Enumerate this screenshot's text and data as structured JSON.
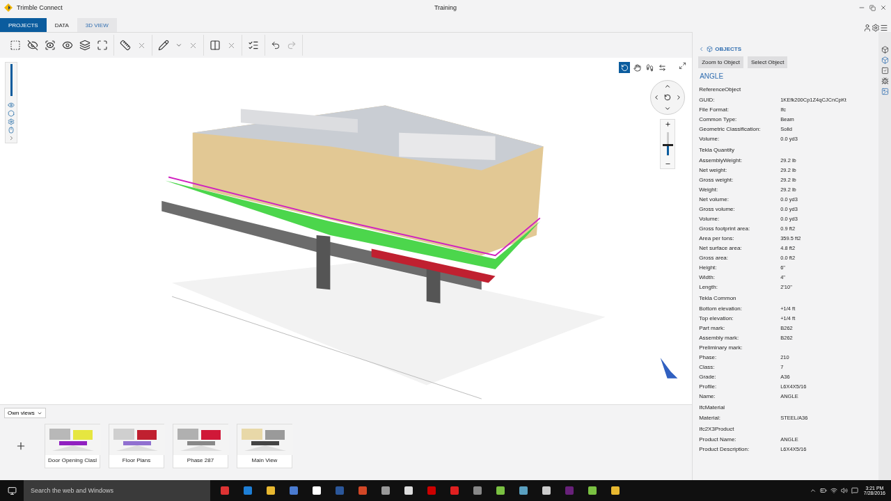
{
  "window": {
    "app_title": "Trimble Connect",
    "title": "Training"
  },
  "projects_button": "PROJECTS",
  "tabs": [
    {
      "label": "DATA",
      "selected": false
    },
    {
      "label": "3D VIEW",
      "selected": true
    }
  ],
  "toolbar": {
    "redo_disabled": true
  },
  "navigation_modes": [
    {
      "kind": "orbit",
      "selected": true
    },
    {
      "kind": "pan",
      "selected": false
    },
    {
      "kind": "walk",
      "selected": false
    },
    {
      "kind": "swap",
      "selected": false
    }
  ],
  "zoom": {
    "level": 0.45
  },
  "views": {
    "filter": "Own views",
    "items": [
      {
        "label": "Door Opening Clasl",
        "kind": "picture"
      },
      {
        "label": "Floor Plans",
        "kind": "picture"
      },
      {
        "label": "Phase 287",
        "kind": "picture"
      },
      {
        "label": "Main View",
        "kind": "picture"
      }
    ]
  },
  "panel": {
    "back_title": "OBJECTS",
    "buttons": [
      "Zoom to Object",
      "Select Object"
    ],
    "title": "ANGLE",
    "groups": [
      {
        "title": "ReferenceObject",
        "rows": [
          {
            "label": "GUID:",
            "value": "1KEfk200Cp1Z4qCJCnCpKt"
          },
          {
            "label": "File Format:",
            "value": "Ifc"
          },
          {
            "label": "Common Type:",
            "value": "Beam"
          },
          {
            "label": "Geometric Classification:",
            "value": "Solid"
          },
          {
            "label": "Volume:",
            "value": "0.0 yd3"
          }
        ]
      },
      {
        "title": "Tekla Quantity",
        "rows": [
          {
            "label": "AssemblyWeight:",
            "value": "29.2 lb"
          },
          {
            "label": "Net weight:",
            "value": "29.2 lb"
          },
          {
            "label": "Gross weight:",
            "value": "29.2 lb"
          },
          {
            "label": "Weight:",
            "value": "29.2 lb"
          },
          {
            "label": "Net volume:",
            "value": "0.0 yd3"
          },
          {
            "label": "Gross volume:",
            "value": "0.0 yd3"
          },
          {
            "label": "Volume:",
            "value": "0.0 yd3"
          },
          {
            "label": "Gross footprint area:",
            "value": "0.9 ft2"
          },
          {
            "label": "Area per tons:",
            "value": "359.5 ft2"
          },
          {
            "label": "Net surface area:",
            "value": "4.8 ft2"
          },
          {
            "label": "Gross area:",
            "value": "0.0 ft2"
          },
          {
            "label": "Height:",
            "value": "6\""
          },
          {
            "label": "Width:",
            "value": "4\""
          },
          {
            "label": "Length:",
            "value": "2'10\""
          }
        ]
      },
      {
        "title": "Tekla Common",
        "rows": [
          {
            "label": "Bottom elevation:",
            "value": "+1/4 ft"
          },
          {
            "label": "Top elevation:",
            "value": "+1/4 ft"
          },
          {
            "label": "Part mark:",
            "value": "B262"
          },
          {
            "label": "Assembly mark:",
            "value": "B262"
          },
          {
            "label": "Preliminary mark:"
          },
          {
            "label": "Phase:",
            "value": "210"
          },
          {
            "label": "Class:",
            "value": "7"
          },
          {
            "label": "Grade:",
            "value": "A36"
          },
          {
            "label": "Profile:",
            "value": "L6X4X5/16"
          },
          {
            "label": "Name:",
            "value": "ANGLE"
          }
        ]
      },
      {
        "title": "IfcMaterial",
        "rows": [
          {
            "label": "Material:",
            "value": "STEEL/A36"
          }
        ]
      },
      {
        "title": "Ifc2X3Product",
        "rows": [
          {
            "label": "Product Name:",
            "value": "ANGLE"
          },
          {
            "label": "Product Description:",
            "value": "L6X4X5/16"
          }
        ]
      }
    ]
  },
  "taskbar": {
    "search_placeholder": "Search the web and Windows",
    "time": "3:21 PM",
    "date": "7/28/2016"
  }
}
